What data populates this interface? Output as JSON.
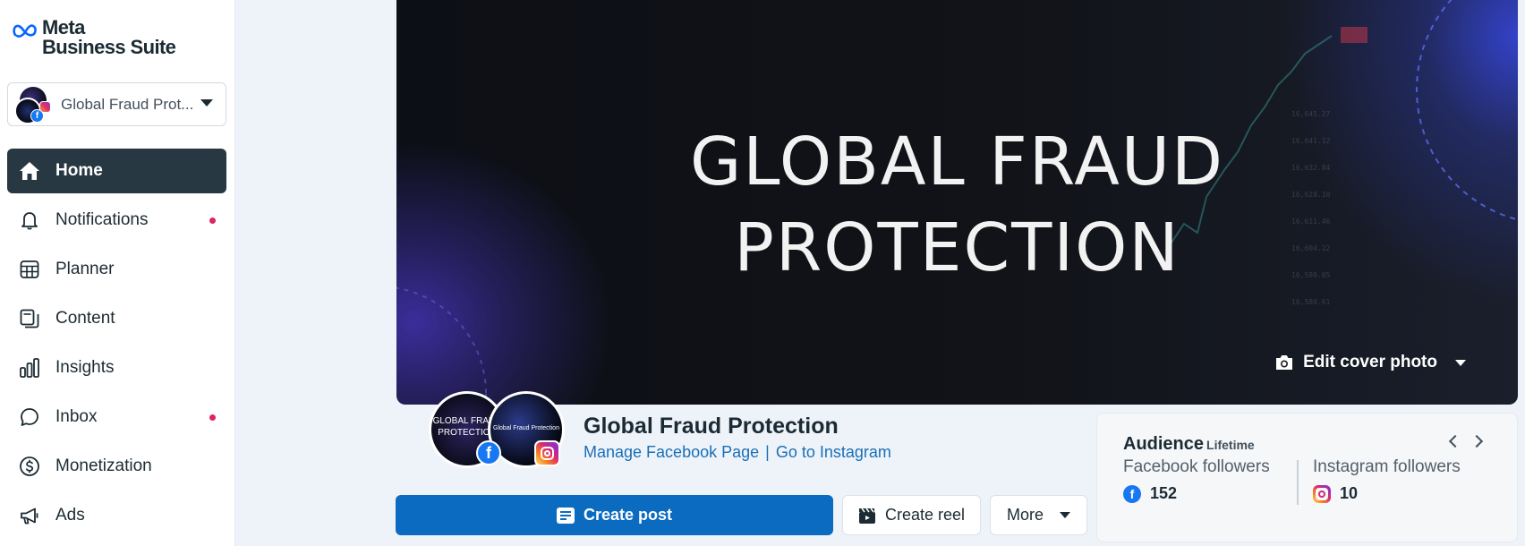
{
  "app": {
    "logo_line1": "Meta",
    "logo_line2": "Business Suite"
  },
  "account_switcher": {
    "name": "Global Fraud Prot..."
  },
  "nav": {
    "items": [
      {
        "label": "Home",
        "icon": "home-icon",
        "active": true
      },
      {
        "label": "Notifications",
        "icon": "bell-icon",
        "has_dot": true
      },
      {
        "label": "Planner",
        "icon": "calendar-grid-icon"
      },
      {
        "label": "Content",
        "icon": "content-icon"
      },
      {
        "label": "Insights",
        "icon": "bar-chart-icon"
      },
      {
        "label": "Inbox",
        "icon": "chat-bubble-icon",
        "has_dot": true
      },
      {
        "label": "Monetization",
        "icon": "dollar-circle-icon"
      },
      {
        "label": "Ads",
        "icon": "megaphone-icon"
      }
    ]
  },
  "cover": {
    "headline_line1": "GLOBAL FRAUD",
    "headline_line2": "PROTECTION",
    "edit_label": "Edit cover photo"
  },
  "profile": {
    "fb_avatar_text": "GLOBAL FRAUD PROTECTION",
    "ig_avatar_text": "Global Fraud Protection",
    "page_name": "Global Fraud Protection",
    "manage_link": "Manage Facebook Page",
    "separator": "|",
    "instagram_link": "Go to Instagram"
  },
  "actions": {
    "create_post": "Create post",
    "create_reel": "Create reel",
    "more": "More"
  },
  "audience": {
    "title": "Audience",
    "period": "Lifetime",
    "facebook_label": "Facebook followers",
    "facebook_value": "152",
    "instagram_label": "Instagram followers",
    "instagram_value": "10"
  },
  "colors": {
    "nav_active_bg": "#283842",
    "primary_button": "#0b6bc0",
    "link": "#1b6fb5",
    "notification_dot": "#e0245e",
    "facebook_blue": "#1877f2"
  }
}
